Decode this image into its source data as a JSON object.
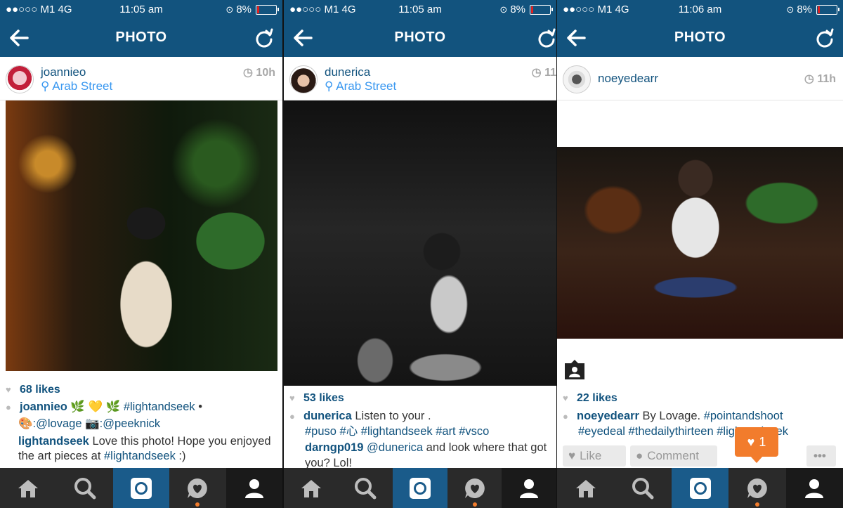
{
  "status": [
    {
      "carrier": "●●○○○ M1  4G",
      "time": "11:05 am",
      "battery": "8%"
    },
    {
      "carrier": "●●○○○ M1  4G",
      "time": "11:05 am",
      "battery": "8%"
    },
    {
      "carrier": "●●○○○ M1  4G",
      "time": "11:06 am",
      "battery": "8%"
    }
  ],
  "nav_title": "PHOTO",
  "posts": [
    {
      "username": "joannieo",
      "location": "Arab Street",
      "time": "10h",
      "likes": "68 likes",
      "caption_user": "joannieo",
      "caption_text": " 🌿 💛 🌿 ",
      "caption_tag": "#lightandseek",
      "caption_bullet": " •",
      "credit1": ":@lovage",
      "credit2": ":@peeknick",
      "comment_user": "lightandseek",
      "comment_text": " Love this photo! Hope you enjoyed the art pieces at ",
      "comment_tag": "#lightandseek",
      "comment_end": " :)"
    },
    {
      "username": "dunerica",
      "location": "Arab Street",
      "time": "11",
      "likes": "53 likes",
      "caption_user": "dunerica",
      "caption_text": " Listen to your .",
      "caption_tags": "#puso #心 #lightandseek #art #vsco",
      "comment_user": "darngp019",
      "comment_mention": " @dunerica",
      "comment_text": " and look where that got you? Lol!"
    },
    {
      "username": "noeyedearr",
      "time": "11h",
      "likes": "22 likes",
      "caption_user": "noeyedearr",
      "caption_text": " By Lovage. ",
      "caption_tag1": "#pointandshoot",
      "caption_tags2": "#eyedeal #thedailythirteen #lightandseek",
      "like_label": "Like",
      "comment_label": "Comment",
      "more_label": "•••"
    }
  ],
  "notification": {
    "count": "1"
  },
  "colors": {
    "brand": "#12537e",
    "accent": "#f27c2c",
    "link": "#3897f0"
  },
  "tabs": [
    "home-icon",
    "search-icon",
    "camera-icon",
    "activity-icon",
    "profile-icon"
  ]
}
